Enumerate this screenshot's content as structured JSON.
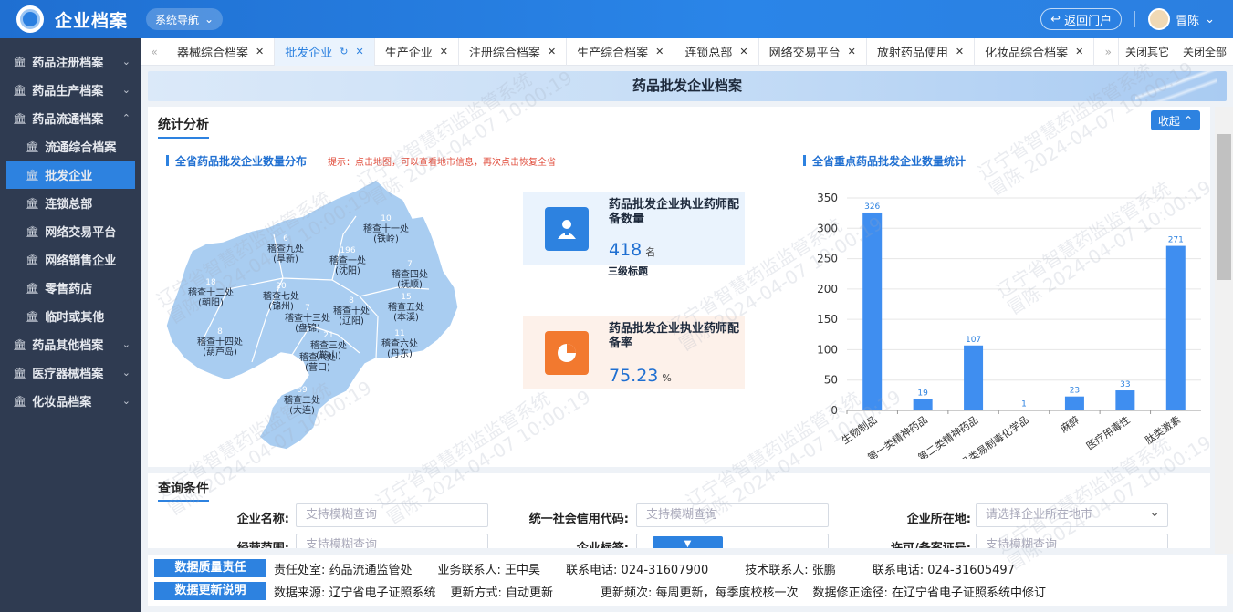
{
  "app": {
    "title": "企业档案",
    "nav_label": "系统导航",
    "back_label": "返回门户",
    "user_name": "冒陈"
  },
  "sidebar": {
    "groups": [
      {
        "label": "药品注册档案"
      },
      {
        "label": "药品生产档案"
      },
      {
        "label": "药品流通档案"
      },
      {
        "label": "药品其他档案"
      },
      {
        "label": "医疗器械档案"
      },
      {
        "label": "化妆品档案"
      }
    ],
    "sub_items": [
      {
        "label": "流通综合档案"
      },
      {
        "label": "批发企业"
      },
      {
        "label": "连锁总部"
      },
      {
        "label": "网络交易平台"
      },
      {
        "label": "网络销售企业"
      },
      {
        "label": "零售药店"
      },
      {
        "label": "临时或其他"
      }
    ]
  },
  "tabs": {
    "items": [
      {
        "label": "器械综合档案"
      },
      {
        "label": "批发企业"
      },
      {
        "label": "生产企业"
      },
      {
        "label": "注册综合档案"
      },
      {
        "label": "生产综合档案"
      },
      {
        "label": "连锁总部"
      },
      {
        "label": "网络交易平台"
      },
      {
        "label": "放射药品使用"
      },
      {
        "label": "化妆品综合档案"
      }
    ],
    "close_others": "关闭其它",
    "close_all": "关闭全部"
  },
  "banner": {
    "title": "药品批发企业档案"
  },
  "stats": {
    "title": "统计分析",
    "collapse_label": "收起",
    "map_title": "全省药品批发企业数量分布",
    "map_hint": "提示：点击地图，可以查看地市信息，再次点击恢复全省",
    "chart_title": "全省重点药品批发企业数量统计",
    "regions": [
      {
        "count": "10",
        "name": "稽查十一处",
        "city": "(铁岭)"
      },
      {
        "count": "6",
        "name": "稽查九处",
        "city": "(阜新)"
      },
      {
        "count": "196",
        "name": "稽查一处",
        "city": "(沈阳)"
      },
      {
        "count": "7",
        "name": "稽查四处",
        "city": "(抚顺)"
      },
      {
        "count": "18",
        "name": "稽查十二处",
        "city": "(朝阳)"
      },
      {
        "count": "20",
        "name": "稽查七处",
        "city": "(锦州)"
      },
      {
        "count": "7",
        "name": "稽查十三处",
        "city": "(盘锦)"
      },
      {
        "count": "8",
        "name": "稽查十处",
        "city": "(辽阳)"
      },
      {
        "count": "15",
        "name": "稽查五处",
        "city": "(本溪)"
      },
      {
        "count": "8",
        "name": "稽查十四处",
        "city": "(葫芦岛)"
      },
      {
        "count": "21",
        "name": "稽查三处",
        "city": "(鞍山)"
      },
      {
        "count": "",
        "name": "稽查八处",
        "city": "(营口)"
      },
      {
        "count": "11",
        "name": "稽查六处",
        "city": "(丹东)"
      },
      {
        "count": "69",
        "name": "稽查二处",
        "city": "(大连)"
      }
    ],
    "card1": {
      "label": "药品批发企业执业药师配备数量",
      "value": "418",
      "unit": "名",
      "sub": "三级标题"
    },
    "card2": {
      "label": "药品批发企业执业药师配备率",
      "value": "75.23",
      "unit": "%"
    }
  },
  "chart_data": {
    "type": "bar",
    "categories": [
      "生物制品",
      "第一类精神药品",
      "第二类精神药品",
      "药品类易制毒化学品",
      "麻醉",
      "医疗用毒性",
      "肽类激素"
    ],
    "values": [
      326,
      19,
      107,
      1,
      23,
      33,
      271
    ],
    "ylim": [
      0,
      350
    ],
    "yticks": [
      0,
      50,
      100,
      150,
      200,
      250,
      300,
      350
    ],
    "color": "#3f8ef0"
  },
  "query": {
    "title": "查询条件",
    "name_label": "企业名称:",
    "name_placeholder": "支持模糊查询",
    "credit_label": "统一社会信用代码:",
    "credit_placeholder": "支持模糊查询",
    "location_label": "企业所在地:",
    "location_placeholder": "请选择企业所在地市",
    "scope_label": "经营范围:",
    "scope_placeholder": "支持模糊查询",
    "tag_label": "企业标签:",
    "license_label": "许可/备案证号:",
    "license_placeholder": "支持模糊查询"
  },
  "footer": {
    "row1_badge": "数据质量责任",
    "row1_items": [
      "责任处室: 药品流通监管处",
      "业务联系人: 王中昊",
      "联系电话: 024-31607900",
      "技术联系人: 张鹏",
      "联系电话: 024-31605497"
    ],
    "row2_badge": "数据更新说明",
    "row2_items": [
      "数据来源: 辽宁省电子证照系统",
      "更新方式: 自动更新",
      "更新频次: 每周更新，每季度校核一次",
      "数据修正途径: 在辽宁省电子证照系统中修订"
    ]
  },
  "watermark": {
    "line1": "辽宁省智慧药监监管系统",
    "line2": "冒陈 2024-04-07 10:00:19"
  }
}
